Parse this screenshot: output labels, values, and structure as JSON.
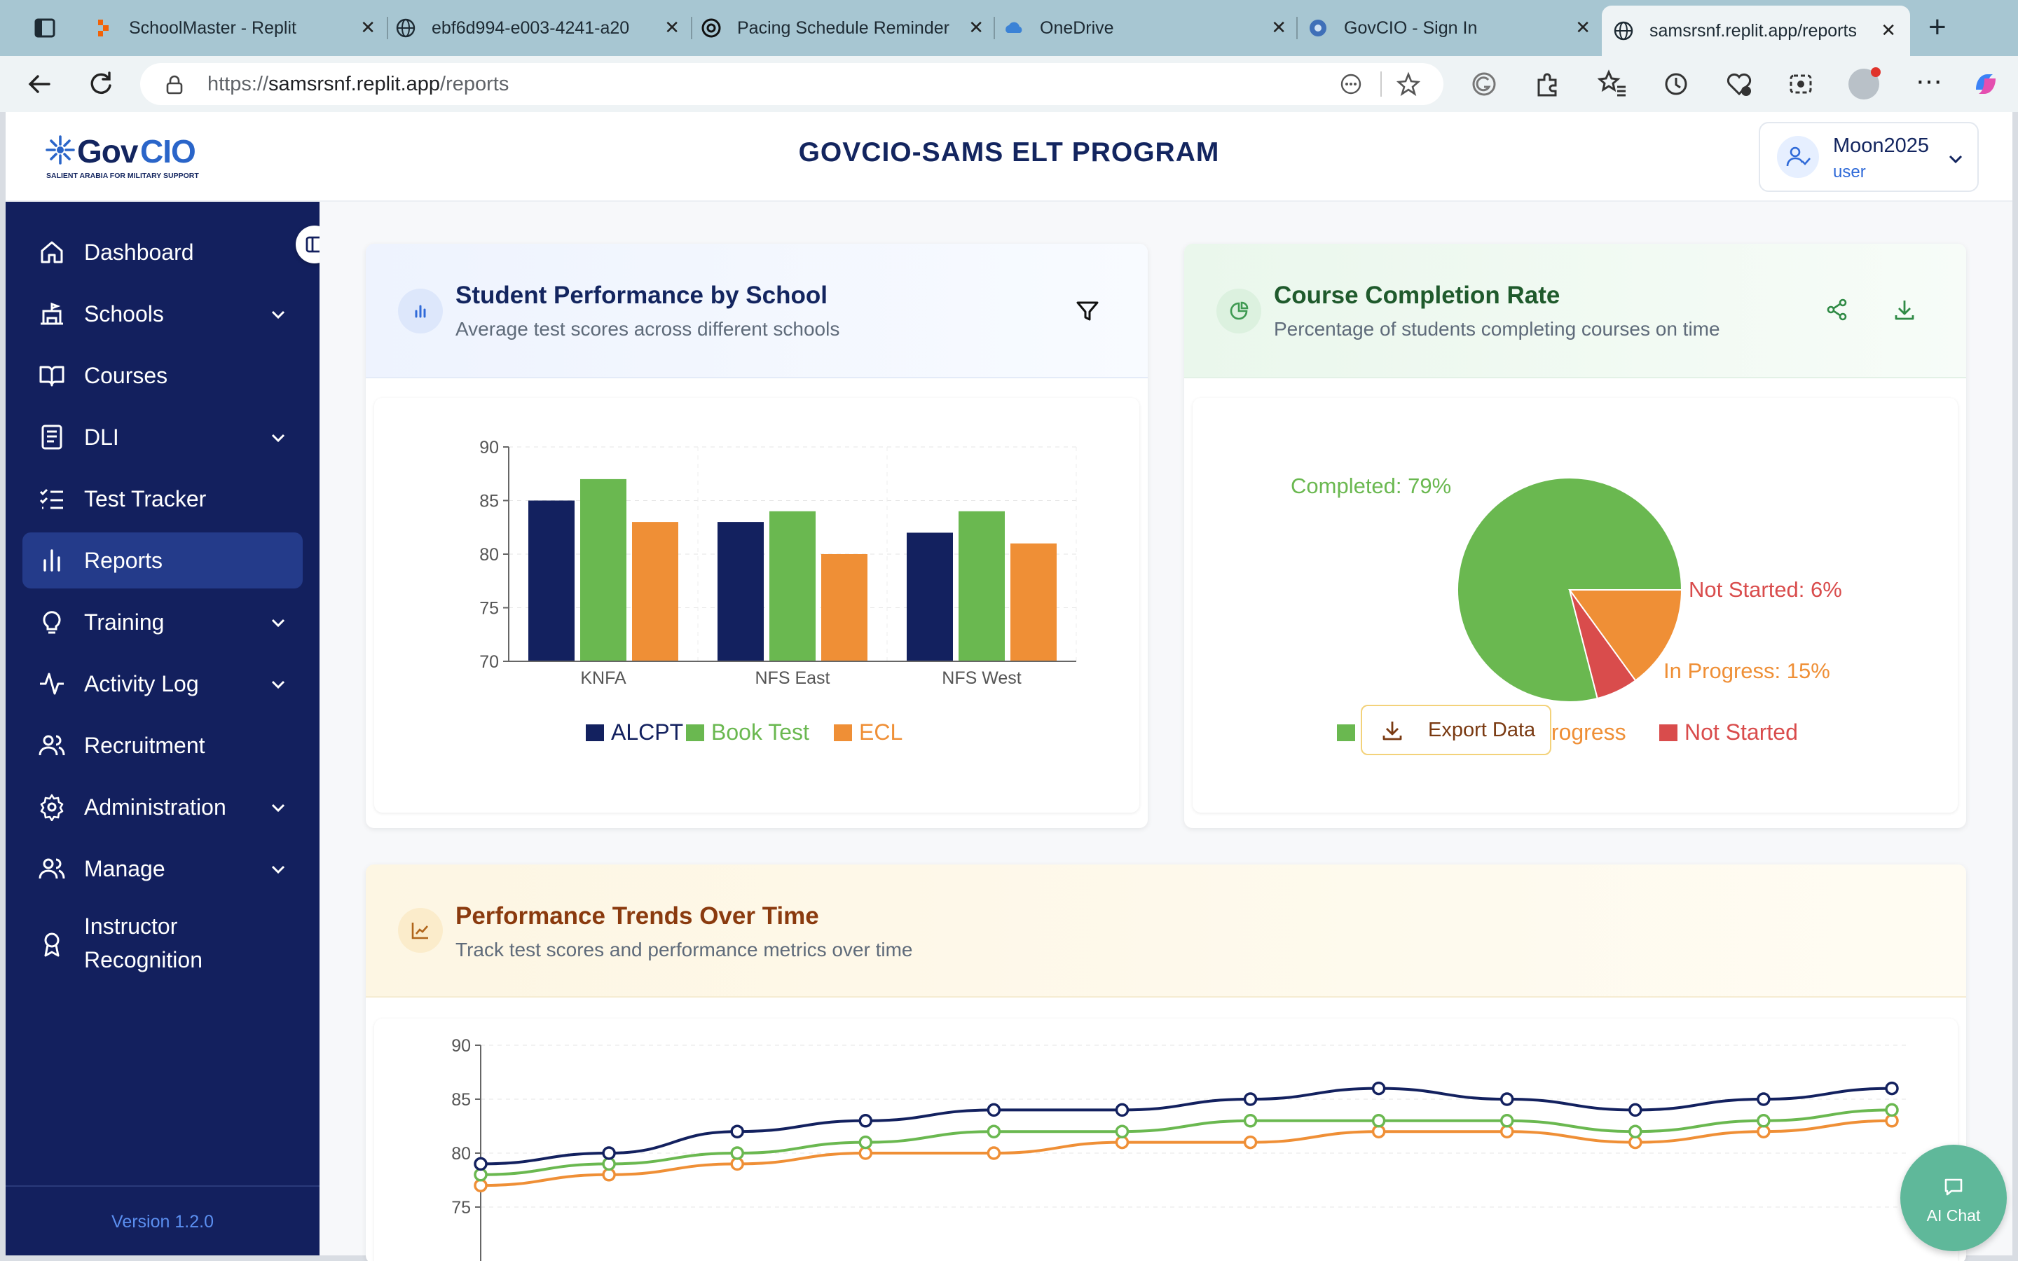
{
  "browser": {
    "tabs": [
      {
        "title": "SchoolMaster - Replit",
        "icon": "replit-icon"
      },
      {
        "title": "ebf6d994-e003-4241-a20",
        "icon": "globe-icon"
      },
      {
        "title": "Pacing Schedule Reminder",
        "icon": "chatgpt-icon"
      },
      {
        "title": "OneDrive",
        "icon": "cloud-icon"
      },
      {
        "title": "GovCIO - Sign In",
        "icon": "circle-icon"
      },
      {
        "title": "samsrsnf.replit.app/reports",
        "icon": "globe-icon",
        "active": true
      }
    ],
    "url_prefix": "https://",
    "url_host": "samsrsnf.replit.app",
    "url_path": "/reports"
  },
  "header": {
    "logo_text": "GovCIO",
    "logo_tagline": "SALIENT ARABIA FOR MILITARY SUPPORT",
    "title": "GOVCIO-SAMS ELT PROGRAM",
    "user": {
      "name": "Moon2025",
      "role": "user"
    }
  },
  "sidebar": {
    "items": [
      {
        "label": "Dashboard",
        "icon": "home-icon"
      },
      {
        "label": "Schools",
        "icon": "school-icon",
        "expandable": true
      },
      {
        "label": "Courses",
        "icon": "book-icon"
      },
      {
        "label": "DLI",
        "icon": "document-icon",
        "expandable": true
      },
      {
        "label": "Test Tracker",
        "icon": "checklist-icon"
      },
      {
        "label": "Reports",
        "icon": "bar-chart-icon",
        "active": true
      },
      {
        "label": "Training",
        "icon": "lightbulb-icon",
        "expandable": true
      },
      {
        "label": "Activity Log",
        "icon": "activity-icon",
        "expandable": true
      },
      {
        "label": "Recruitment",
        "icon": "users-icon"
      },
      {
        "label": "Administration",
        "icon": "gear-icon",
        "expandable": true
      },
      {
        "label": "Manage",
        "icon": "users-icon",
        "expandable": true
      },
      {
        "label": "Instructor",
        "label2": "Recognition",
        "icon": "award-icon"
      }
    ],
    "version": "Version 1.2.0"
  },
  "cards": {
    "performance": {
      "title": "Student Performance by School",
      "subtitle": "Average test scores across different schools"
    },
    "completion": {
      "title": "Course Completion Rate",
      "subtitle": "Percentage of students completing courses on time"
    },
    "trends": {
      "title": "Performance Trends Over Time",
      "subtitle": "Track test scores and performance metrics over time",
      "export_label": "Export Data"
    }
  },
  "colors": {
    "alcpt": "#13215f",
    "book": "#6ab850",
    "ecl": "#ef8f36",
    "not_started": "#d94c4c"
  },
  "chart_data": [
    {
      "type": "bar",
      "categories": [
        "KNFA",
        "NFS East",
        "NFS West"
      ],
      "series": [
        {
          "name": "ALCPT",
          "values": [
            85,
            83,
            82
          ]
        },
        {
          "name": "Book Test",
          "values": [
            87,
            84,
            84
          ]
        },
        {
          "name": "ECL",
          "values": [
            83,
            80,
            81
          ]
        }
      ],
      "ylim": [
        70,
        90
      ],
      "yticks": [
        70,
        75,
        80,
        85,
        90
      ],
      "legend": "bottom"
    },
    {
      "type": "pie",
      "slices": [
        {
          "name": "Completed",
          "value": 79,
          "label": "Completed: 79%"
        },
        {
          "name": "In Progress",
          "value": 15,
          "label": "In Progress: 15%"
        },
        {
          "name": "Not Started",
          "value": 6,
          "label": "Not Started: 6%"
        }
      ],
      "legend": "bottom"
    },
    {
      "type": "line",
      "series": [
        {
          "values": [
            79,
            80,
            82,
            83,
            84,
            84,
            85,
            86,
            85,
            84,
            85,
            86
          ]
        },
        {
          "values": [
            78,
            79,
            80,
            81,
            82,
            82,
            83,
            83,
            83,
            82,
            83,
            84
          ]
        },
        {
          "values": [
            77,
            78,
            79,
            80,
            80,
            81,
            81,
            82,
            82,
            81,
            82,
            83
          ]
        }
      ],
      "yticks": [
        75,
        80,
        85,
        90
      ],
      "ylim": [
        70,
        90
      ]
    }
  ],
  "ai_chat": {
    "label": "AI Chat"
  }
}
